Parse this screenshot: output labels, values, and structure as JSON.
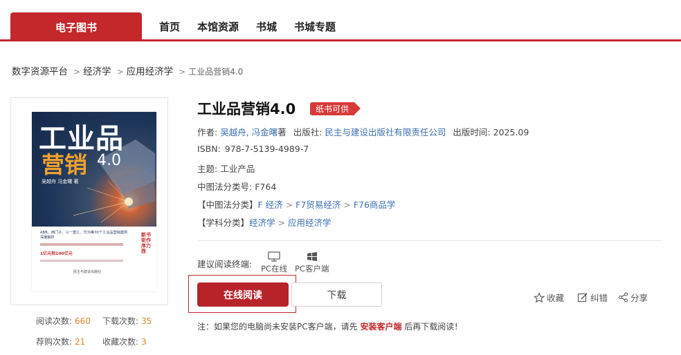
{
  "nav": {
    "brand": "电子图书",
    "links": [
      "首页",
      "本馆资源",
      "书城",
      "书城专题"
    ]
  },
  "breadcrumb": [
    "数字资源平台",
    "经济学",
    "应用经济学",
    "工业品营销4.0"
  ],
  "cover": {
    "title_line1": "工业品",
    "title_line2": "营销",
    "version": "4.0",
    "authors": "吴越舟  冯金曙  著",
    "side_text": "新书钜作序力荐",
    "blurb": "ABB、西门子、三一重工、华为等30个工业品营销案例深度解析",
    "blurb2": "1亿元到100亿元",
    "publisher": "民主与建设出版社"
  },
  "stats": {
    "reads_label": "阅读次数:",
    "reads": "660",
    "downloads_label": "下载次数:",
    "downloads": "35",
    "recommend_label": "荐购次数:",
    "recommend": "21",
    "favorites_label": "收藏次数:",
    "favorites": "3"
  },
  "book": {
    "title": "工业品营销4.0",
    "badge": "纸书可供",
    "author_label": "作者:",
    "authors": "吴越舟, 冯金曙",
    "author_suffix": "著",
    "publisher_label": "出版社:",
    "publisher": "民主与建设出版社有限责任公司",
    "pubdate_label": "出版时间:",
    "pubdate": "2025.09",
    "isbn_label": "ISBN:",
    "isbn": "978-7-5139-4989-7",
    "subject_label": "主题:",
    "subject": "工业产品",
    "clc_label": "中图法分类号:",
    "clc": "F764",
    "clc_cat_label": "【中图法分类】",
    "clc_cat": [
      "F 经济",
      "F7贸易经济",
      "F76商品学"
    ],
    "discipline_label": "【学科分类】",
    "discipline": [
      "经济学",
      "应用经济学"
    ]
  },
  "terminals": {
    "label": "建议阅读终端:",
    "items": [
      {
        "icon": "monitor-icon",
        "label": "PC在线"
      },
      {
        "icon": "windows-icon",
        "label": "PC客户端"
      }
    ]
  },
  "actions": {
    "read_online": "在线阅读",
    "download": "下载",
    "favorite": "收藏",
    "report": "纠错",
    "share": "分享"
  },
  "note": {
    "prefix": "注：如果您的电脑尚未安装PC客户端，请先",
    "link": "安装客户端",
    "suffix": "后再下载阅读！"
  },
  "colors": {
    "brand_red": "#c4282b",
    "link_blue": "#3a6fb0",
    "stat_orange": "#d9852a"
  }
}
